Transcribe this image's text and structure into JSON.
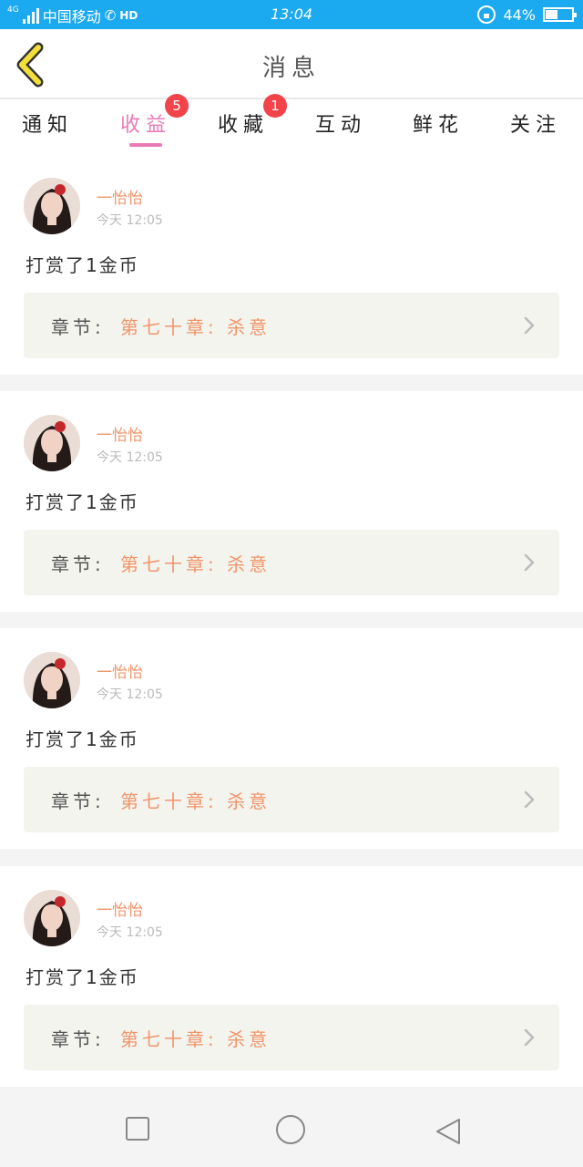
{
  "status_bar": {
    "network": "4G",
    "carrier": "中国移动",
    "hd": "HD",
    "time": "13:04",
    "battery": "44%",
    "battery_level": 0.44
  },
  "header": {
    "title": "消息",
    "back_icon": "chevron-left-icon"
  },
  "tabs": [
    {
      "label": "通知",
      "active": false,
      "badge": ""
    },
    {
      "label": "收益",
      "active": true,
      "badge": "5"
    },
    {
      "label": "收藏",
      "active": false,
      "badge": "1"
    },
    {
      "label": "互动",
      "active": false,
      "badge": ""
    },
    {
      "label": "鲜花",
      "active": false,
      "badge": ""
    },
    {
      "label": "关注",
      "active": false,
      "badge": ""
    }
  ],
  "messages": [
    {
      "user": "一怡怡",
      "time": "今天 12:05",
      "content": "打赏了1金币",
      "chapter_label": "章节:",
      "chapter_title": "第七十章: 杀意"
    },
    {
      "user": "一怡怡",
      "time": "今天 12:05",
      "content": "打赏了1金币",
      "chapter_label": "章节:",
      "chapter_title": "第七十章: 杀意"
    },
    {
      "user": "一怡怡",
      "time": "今天 12:05",
      "content": "打赏了1金币",
      "chapter_label": "章节:",
      "chapter_title": "第七十章: 杀意"
    },
    {
      "user": "一怡怡",
      "time": "今天 12:05",
      "content": "打赏了1金币",
      "chapter_label": "章节:",
      "chapter_title": "第七十章: 杀意"
    }
  ],
  "colors": {
    "status_bar": "#1ba9f0",
    "accent_pink": "#e97ab6",
    "accent_orange": "#f0956a",
    "badge_red": "#f2434b",
    "back_icon": "#f2df3a"
  },
  "nav_icons": [
    "recent-apps-icon",
    "home-icon",
    "back-icon"
  ]
}
